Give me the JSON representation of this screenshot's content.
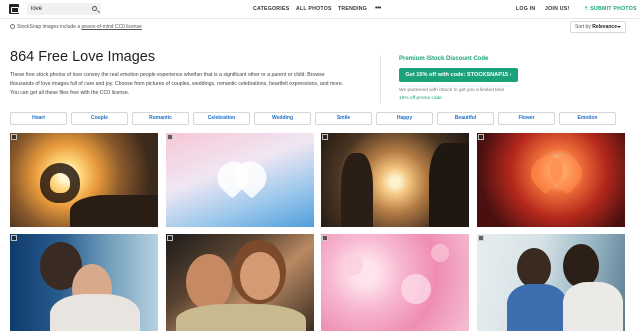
{
  "nav": {
    "search_value": "love",
    "links": [
      "CATEGORIES",
      "ALL PHOTOS",
      "TRENDING"
    ],
    "more": "•••",
    "right": [
      "LOG IN",
      "JOIN US!",
      "SUBMIT PHOTOS"
    ]
  },
  "subbar": {
    "cc_text": "StockSnap images include a ",
    "cc_link": "peace-of-mind CC0 license",
    "sort_label": "Sort by",
    "sort_value": "Relevance"
  },
  "page": {
    "title": "864 Free Love Images",
    "description": "These free stock photos of love convey the real emotion people experience whether that is a significant other or a parent or child. Browse thousands of love images full of care and joy. Choose from pictures of couples, weddings, romantic celebrations, heartfelt expressions, and more. You can get all these files free with the CC0 license."
  },
  "promo": {
    "title": "Premium iStock Discount Code",
    "button": "Get 15% off with code: STOCKSNAP15 ›",
    "note": "We partnered with iStock to get you a limited time ",
    "note_link": "15% off promo code",
    "note_end": "."
  },
  "tags": [
    "Heart",
    "Couple",
    "Romantic",
    "Celebration",
    "Wedding",
    "Smile",
    "Happy",
    "Beautiful",
    "Flower",
    "Emotion"
  ],
  "colors": {
    "accent": "#1aa37a",
    "tag_text": "#1e70c8"
  }
}
